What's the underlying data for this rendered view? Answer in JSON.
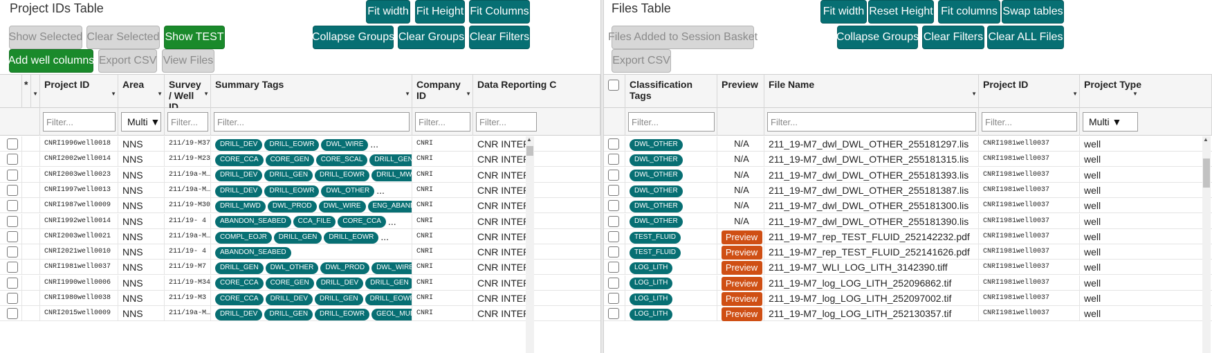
{
  "left": {
    "title": "Project IDs Table",
    "buttons": {
      "fit_width": "Fit width",
      "fit_height": "Fit Height",
      "fit_columns": "Fit Columns",
      "show_selected": "Show Selected",
      "clear_selected": "Clear Selected",
      "show_test": "Show TEST",
      "collapse_groups": "Collapse Groups",
      "clear_groups": "Clear Groups",
      "clear_filters": "Clear Filters",
      "add_well_columns": "Add well columns",
      "export_csv": "Export CSV",
      "view_files": "View Files"
    },
    "columns": {
      "star": "*",
      "project_id": "Project ID",
      "area": "Area",
      "survey": "Survey / Well ID",
      "summary_tags": "Summary Tags",
      "company_id": "Company ID",
      "data_reporting": "Data Reporting C"
    },
    "filter_placeholder": "Filter...",
    "area_filter": "Multi ▼",
    "rows": [
      {
        "project_id": "CNRI1996well0018",
        "area": "NNS",
        "survey": "211/19-M37",
        "tags": [
          "DRILL_DEV",
          "DRILL_EOWR",
          "DWL_WIRE"
        ],
        "more": "...",
        "company": "CNRI",
        "reporting": "CNR INTERN"
      },
      {
        "project_id": "CNRI2002well0014",
        "area": "NNS",
        "survey": "211/19-M23",
        "tags": [
          "CORE_CCA",
          "CORE_GEN",
          "CORE_SCAL",
          "DRILL_GEN"
        ],
        "more": "",
        "company": "CNRI",
        "reporting": "CNR INTERN"
      },
      {
        "project_id": "CNRI2003well0023",
        "area": "NNS",
        "survey": "211/19a-M…",
        "tags": [
          "DRILL_DEV",
          "DRILL_GEN",
          "DRILL_EOWR",
          "DRILL_MWD"
        ],
        "more": "",
        "company": "CNRI",
        "reporting": "CNR INTERN"
      },
      {
        "project_id": "CNRI1997well0013",
        "area": "NNS",
        "survey": "211/19a-M…",
        "tags": [
          "DRILL_DEV",
          "DRILL_EOWR",
          "DWL_OTHER"
        ],
        "more": "...",
        "company": "CNRI",
        "reporting": "CNR INTERN"
      },
      {
        "project_id": "CNRI1987well0009",
        "area": "NNS",
        "survey": "211/19-M30",
        "tags": [
          "DRILL_MWD",
          "DWL_PROD",
          "DWL_WIRE",
          "ENG_ABAND"
        ],
        "more": "",
        "company": "CNRI",
        "reporting": "CNR INTERN"
      },
      {
        "project_id": "CNRI1992well0014",
        "area": "NNS",
        "survey": "211/19- 4",
        "tags": [
          "ABANDON_SEABED",
          "CCA_FILE",
          "CORE_CCA"
        ],
        "more": "...",
        "company": "CNRI",
        "reporting": "CNR INTERN"
      },
      {
        "project_id": "CNRI2003well0021",
        "area": "NNS",
        "survey": "211/19a-M…",
        "tags": [
          "COMPL_EOJR",
          "DRILL_GEN",
          "DRILL_EOWR"
        ],
        "more": "...",
        "company": "CNRI",
        "reporting": "CNR INTERN"
      },
      {
        "project_id": "CNRI2021well0010",
        "area": "NNS",
        "survey": "211/19- 4",
        "tags": [
          "ABANDON_SEABED"
        ],
        "more": "",
        "company": "CNRI",
        "reporting": "CNR INTERN"
      },
      {
        "project_id": "CNRI1981well0037",
        "area": "NNS",
        "survey": "211/19-M7",
        "tags": [
          "DRILL_GEN",
          "DWL_OTHER",
          "DWL_PROD",
          "DWL_WIRE"
        ],
        "more": "...",
        "company": "CNRI",
        "reporting": "CNR INTERN"
      },
      {
        "project_id": "CNRI1990well0006",
        "area": "NNS",
        "survey": "211/19-M34",
        "tags": [
          "CORE_CCA",
          "CORE_GEN",
          "DRILL_DEV",
          "DRILL_GEN"
        ],
        "more": "",
        "company": "CNRI",
        "reporting": "CNR INTERN"
      },
      {
        "project_id": "CNRI1980well0038",
        "area": "NNS",
        "survey": "211/19-M3",
        "tags": [
          "CORE_CCA",
          "DRILL_DEV",
          "DRILL_GEN",
          "DRILL_EOWR"
        ],
        "more": "",
        "company": "CNRI",
        "reporting": "CNR INTERN"
      },
      {
        "project_id": "CNRI2015well0009",
        "area": "NNS",
        "survey": "211/19a-M…",
        "tags": [
          "DRILL_DEV",
          "DRILL_GEN",
          "DRILL_EOWR",
          "GEOL_MUD"
        ],
        "more": "",
        "company": "CNRI",
        "reporting": "CNR INTERN"
      }
    ]
  },
  "right": {
    "title": "Files Table",
    "buttons": {
      "fit_width": "Fit width",
      "reset_height": "Reset Height",
      "fit_columns": "Fit columns",
      "swap_tables": "Swap tables",
      "files_added": "Files Added to Session Basket",
      "collapse_groups": "Collapse Groups",
      "clear_filters": "Clear Filters",
      "clear_all_files": "Clear ALL Files",
      "export_csv": "Export CSV"
    },
    "columns": {
      "classification": "Classification Tags",
      "preview": "Preview",
      "file_name": "File Name",
      "project_id": "Project ID",
      "project_type": "Project Type"
    },
    "filter_placeholder": "Filter...",
    "type_filter": "Multi ▼",
    "rows": [
      {
        "tag": "DWL_OTHER",
        "preview": "N/A",
        "file": "211_19-M7_dwl_DWL_OTHER_255181297.lis",
        "project_id": "CNRI1981well0037",
        "type": "well"
      },
      {
        "tag": "DWL_OTHER",
        "preview": "N/A",
        "file": "211_19-M7_dwl_DWL_OTHER_255181315.lis",
        "project_id": "CNRI1981well0037",
        "type": "well"
      },
      {
        "tag": "DWL_OTHER",
        "preview": "N/A",
        "file": "211_19-M7_dwl_DWL_OTHER_255181393.lis",
        "project_id": "CNRI1981well0037",
        "type": "well"
      },
      {
        "tag": "DWL_OTHER",
        "preview": "N/A",
        "file": "211_19-M7_dwl_DWL_OTHER_255181387.lis",
        "project_id": "CNRI1981well0037",
        "type": "well"
      },
      {
        "tag": "DWL_OTHER",
        "preview": "N/A",
        "file": "211_19-M7_dwl_DWL_OTHER_255181300.lis",
        "project_id": "CNRI1981well0037",
        "type": "well"
      },
      {
        "tag": "DWL_OTHER",
        "preview": "N/A",
        "file": "211_19-M7_dwl_DWL_OTHER_255181390.lis",
        "project_id": "CNRI1981well0037",
        "type": "well"
      },
      {
        "tag": "TEST_FLUID",
        "preview": "Preview",
        "file": "211_19-M7_rep_TEST_FLUID_252142232.pdf",
        "project_id": "CNRI1981well0037",
        "type": "well"
      },
      {
        "tag": "TEST_FLUID",
        "preview": "Preview",
        "file": "211_19-M7_rep_TEST_FLUID_252141626.pdf",
        "project_id": "CNRI1981well0037",
        "type": "well"
      },
      {
        "tag": "LOG_LITH",
        "preview": "Preview",
        "file": "211_19-M7_WLI_LOG_LITH_3142390.tiff",
        "project_id": "CNRI1981well0037",
        "type": "well"
      },
      {
        "tag": "LOG_LITH",
        "preview": "Preview",
        "file": "211_19-M7_log_LOG_LITH_252096862.tif",
        "project_id": "CNRI1981well0037",
        "type": "well"
      },
      {
        "tag": "LOG_LITH",
        "preview": "Preview",
        "file": "211_19-M7_log_LOG_LITH_252097002.tif",
        "project_id": "CNRI1981well0037",
        "type": "well"
      },
      {
        "tag": "LOG_LITH",
        "preview": "Preview",
        "file": "211_19-M7_log_LOG_LITH_252130357.tif",
        "project_id": "CNRI1981well0037",
        "type": "well"
      }
    ]
  },
  "colors": {
    "teal": "#076f73",
    "green": "#1a8a2b",
    "orange": "#cf4f14",
    "disabled": "#d7d7d7"
  }
}
